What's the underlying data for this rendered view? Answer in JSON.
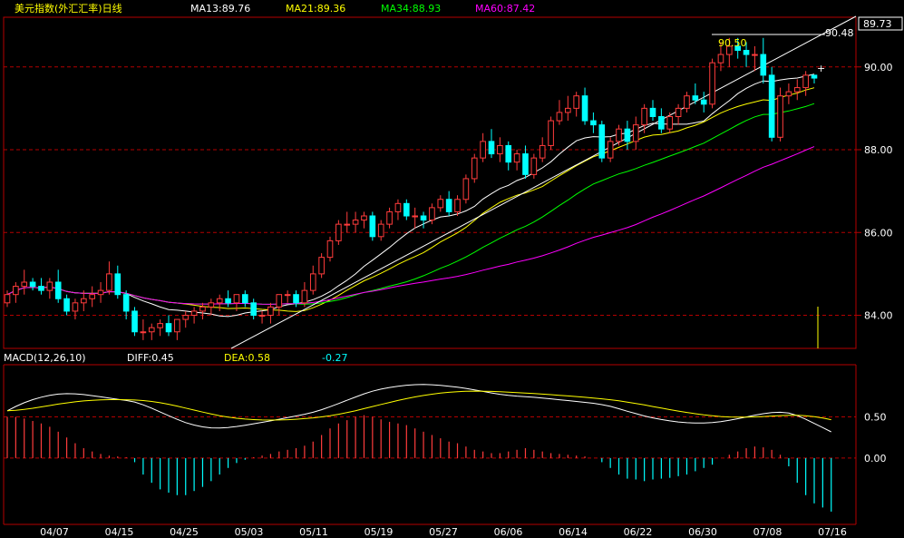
{
  "header": {
    "title": "美元指数(外汇汇率)日线",
    "ma": [
      {
        "label": "MA13:89.76",
        "color": "#ffffff"
      },
      {
        "label": "MA21:89.36",
        "color": "#ffff00"
      },
      {
        "label": "MA34:88.93",
        "color": "#00ff00"
      },
      {
        "label": "MA60:87.42",
        "color": "#ff00ff"
      }
    ]
  },
  "macd_header": {
    "name": "MACD(12,26,10)",
    "diff": "DIFF:0.45",
    "dea": "DEA:0.58",
    "macd": "-0.27"
  },
  "annotations": {
    "current_price": "89.73",
    "high_right": "90.48",
    "high_left": "90.50"
  },
  "colors": {
    "up": "#ff3c3c",
    "down": "#00ffff",
    "ma13": "#ffffff",
    "ma21": "#ffff00",
    "ma34": "#00ff00",
    "ma60": "#ff00ff",
    "grid": "#b40000",
    "axis_text": "#ffffff",
    "title": "#ffff00"
  },
  "chart_data": {
    "type": "candlestick",
    "price_axis": {
      "ticks": [
        "90.00",
        "88.00",
        "86.00",
        "84.00"
      ],
      "range": [
        83.2,
        91.2
      ]
    },
    "macd_axis": {
      "ticks": [
        "0.50",
        "0.00"
      ],
      "range": [
        -0.75,
        1.1
      ]
    },
    "dates": [
      "04/07",
      "04/15",
      "04/25",
      "05/03",
      "05/11",
      "05/19",
      "05/27",
      "06/06",
      "06/14",
      "06/22",
      "06/30",
      "07/08",
      "07/16"
    ],
    "candles": [
      [
        84.3,
        84.6,
        84.2,
        84.5
      ],
      [
        84.5,
        84.8,
        84.3,
        84.7
      ],
      [
        84.7,
        85.1,
        84.5,
        84.8
      ],
      [
        84.8,
        84.9,
        84.6,
        84.7
      ],
      [
        84.7,
        84.9,
        84.5,
        84.6
      ],
      [
        84.6,
        84.9,
        84.4,
        84.8
      ],
      [
        84.8,
        85.1,
        84.3,
        84.4
      ],
      [
        84.4,
        84.5,
        84.0,
        84.1
      ],
      [
        84.1,
        84.4,
        83.9,
        84.3
      ],
      [
        84.3,
        84.6,
        84.1,
        84.4
      ],
      [
        84.4,
        84.7,
        84.2,
        84.5
      ],
      [
        84.5,
        84.8,
        84.3,
        84.6
      ],
      [
        84.6,
        85.3,
        84.5,
        85.0
      ],
      [
        85.0,
        85.2,
        84.4,
        84.5
      ],
      [
        84.5,
        84.6,
        83.9,
        84.1
      ],
      [
        84.1,
        84.2,
        83.5,
        83.6
      ],
      [
        83.6,
        83.9,
        83.4,
        83.6
      ],
      [
        83.6,
        83.8,
        83.4,
        83.7
      ],
      [
        83.7,
        83.9,
        83.5,
        83.8
      ],
      [
        83.8,
        84.0,
        83.5,
        83.6
      ],
      [
        83.6,
        83.9,
        83.4,
        83.9
      ],
      [
        83.9,
        84.1,
        83.7,
        84.0
      ],
      [
        84.0,
        84.2,
        83.8,
        84.1
      ],
      [
        84.1,
        84.3,
        83.9,
        84.2
      ],
      [
        84.2,
        84.4,
        84.0,
        84.3
      ],
      [
        84.3,
        84.5,
        84.1,
        84.4
      ],
      [
        84.4,
        84.6,
        84.2,
        84.3
      ],
      [
        84.3,
        84.5,
        84.1,
        84.5
      ],
      [
        84.5,
        84.6,
        84.2,
        84.3
      ],
      [
        84.3,
        84.4,
        83.9,
        84.0
      ],
      [
        84.0,
        84.1,
        83.8,
        84.0
      ],
      [
        84.0,
        84.3,
        83.8,
        84.2
      ],
      [
        84.2,
        84.5,
        84.0,
        84.5
      ],
      [
        84.5,
        84.6,
        84.3,
        84.5
      ],
      [
        84.5,
        84.6,
        84.2,
        84.3
      ],
      [
        84.3,
        84.8,
        84.2,
        84.6
      ],
      [
        84.6,
        85.2,
        84.5,
        85.0
      ],
      [
        85.0,
        85.5,
        84.9,
        85.4
      ],
      [
        85.4,
        85.9,
        85.3,
        85.8
      ],
      [
        85.8,
        86.3,
        85.7,
        86.2
      ],
      [
        86.2,
        86.5,
        86.0,
        86.2
      ],
      [
        86.2,
        86.5,
        86.0,
        86.3
      ],
      [
        86.3,
        86.5,
        86.1,
        86.4
      ],
      [
        86.4,
        86.5,
        85.8,
        85.9
      ],
      [
        85.9,
        86.3,
        85.8,
        86.2
      ],
      [
        86.2,
        86.6,
        86.1,
        86.5
      ],
      [
        86.5,
        86.8,
        86.3,
        86.7
      ],
      [
        86.7,
        86.8,
        86.3,
        86.4
      ],
      [
        86.4,
        86.6,
        86.1,
        86.4
      ],
      [
        86.4,
        86.5,
        86.1,
        86.3
      ],
      [
        86.3,
        86.7,
        86.2,
        86.6
      ],
      [
        86.6,
        86.9,
        86.5,
        86.8
      ],
      [
        86.8,
        87.0,
        86.4,
        86.5
      ],
      [
        86.5,
        86.9,
        86.4,
        86.8
      ],
      [
        86.8,
        87.4,
        86.7,
        87.3
      ],
      [
        87.3,
        87.9,
        87.2,
        87.8
      ],
      [
        87.8,
        88.4,
        87.7,
        88.2
      ],
      [
        88.2,
        88.5,
        87.8,
        87.9
      ],
      [
        87.9,
        88.3,
        87.7,
        88.1
      ],
      [
        88.1,
        88.2,
        87.5,
        87.7
      ],
      [
        87.7,
        88.0,
        87.5,
        87.9
      ],
      [
        87.9,
        88.1,
        87.3,
        87.4
      ],
      [
        87.4,
        87.9,
        87.3,
        87.8
      ],
      [
        87.8,
        88.3,
        87.7,
        88.1
      ],
      [
        88.1,
        88.8,
        88.0,
        88.7
      ],
      [
        88.7,
        89.2,
        88.6,
        88.9
      ],
      [
        88.9,
        89.3,
        88.7,
        89.0
      ],
      [
        89.0,
        89.4,
        88.8,
        89.3
      ],
      [
        89.3,
        89.5,
        88.6,
        88.7
      ],
      [
        88.7,
        88.9,
        88.4,
        88.6
      ],
      [
        88.6,
        88.7,
        87.7,
        87.8
      ],
      [
        87.8,
        88.3,
        87.7,
        88.2
      ],
      [
        88.2,
        88.6,
        88.1,
        88.5
      ],
      [
        88.5,
        88.7,
        88.0,
        88.2
      ],
      [
        88.2,
        88.8,
        88.0,
        88.6
      ],
      [
        88.6,
        89.1,
        88.4,
        89.0
      ],
      [
        89.0,
        89.2,
        88.7,
        88.8
      ],
      [
        88.8,
        89.0,
        88.4,
        88.5
      ],
      [
        88.5,
        88.9,
        88.4,
        88.8
      ],
      [
        88.8,
        89.1,
        88.6,
        89.0
      ],
      [
        89.0,
        89.4,
        88.9,
        89.3
      ],
      [
        89.3,
        89.6,
        89.1,
        89.2
      ],
      [
        89.2,
        89.4,
        88.9,
        89.1
      ],
      [
        89.1,
        90.2,
        89.0,
        90.1
      ],
      [
        90.1,
        90.6,
        89.9,
        90.3
      ],
      [
        90.3,
        90.7,
        90.0,
        90.5
      ],
      [
        90.5,
        90.7,
        90.2,
        90.4
      ],
      [
        90.4,
        90.6,
        90.0,
        90.3
      ],
      [
        90.3,
        90.5,
        89.9,
        90.3
      ],
      [
        90.3,
        90.7,
        89.6,
        89.8
      ],
      [
        89.8,
        90.0,
        88.2,
        88.3
      ],
      [
        88.3,
        89.5,
        88.2,
        89.3
      ],
      [
        89.3,
        89.6,
        89.1,
        89.4
      ],
      [
        89.4,
        89.7,
        89.2,
        89.5
      ],
      [
        89.5,
        89.9,
        89.3,
        89.8
      ],
      [
        89.8,
        89.8,
        89.6,
        89.73
      ]
    ],
    "macd_hist": [
      0.5,
      0.5,
      0.48,
      0.45,
      0.42,
      0.38,
      0.32,
      0.25,
      0.18,
      0.12,
      0.08,
      0.05,
      0.03,
      0.02,
      0.01,
      -0.05,
      -0.2,
      -0.3,
      -0.38,
      -0.42,
      -0.45,
      -0.45,
      -0.4,
      -0.35,
      -0.28,
      -0.2,
      -0.12,
      -0.06,
      -0.02,
      0.01,
      0.03,
      0.05,
      0.08,
      0.1,
      0.12,
      0.15,
      0.2,
      0.28,
      0.36,
      0.42,
      0.46,
      0.5,
      0.52,
      0.5,
      0.47,
      0.44,
      0.42,
      0.4,
      0.36,
      0.32,
      0.28,
      0.24,
      0.2,
      0.18,
      0.14,
      0.1,
      0.08,
      0.06,
      0.06,
      0.08,
      0.1,
      0.12,
      0.1,
      0.08,
      0.06,
      0.05,
      0.04,
      0.03,
      0.02,
      0.0,
      -0.05,
      -0.12,
      -0.2,
      -0.25,
      -0.26,
      -0.28,
      -0.26,
      -0.25,
      -0.24,
      -0.22,
      -0.2,
      -0.16,
      -0.12,
      -0.08,
      0.0,
      0.04,
      0.08,
      0.12,
      0.14,
      0.13,
      0.1,
      0.04,
      -0.1,
      -0.3,
      -0.45,
      -0.55,
      -0.6,
      -0.65
    ]
  }
}
